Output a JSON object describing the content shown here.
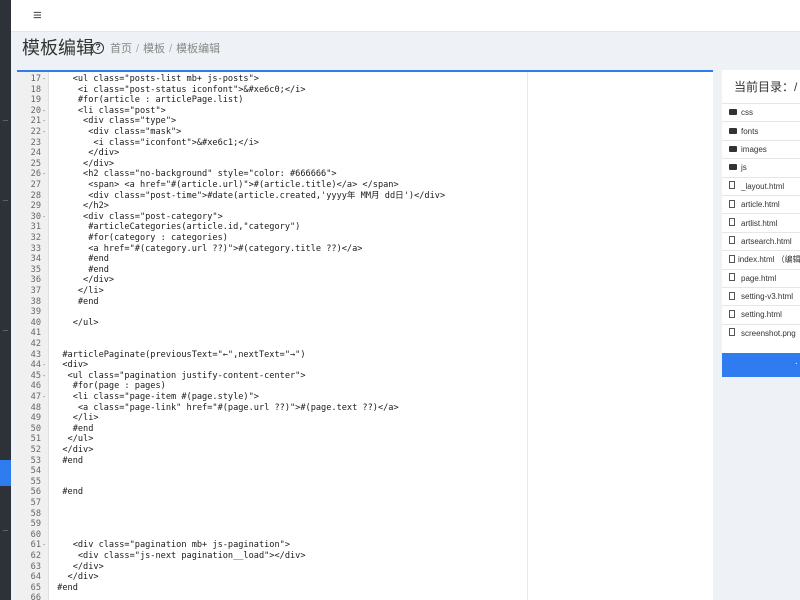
{
  "header": {
    "menu_icon": "menu-icon",
    "page_title": "模板编辑",
    "help_icon": "question-icon"
  },
  "breadcrumb": [
    "首页",
    "模板",
    "模板编辑"
  ],
  "editor": {
    "lines": [
      {
        "n": "17",
        "fold": "-",
        "text": "    <ul class=\"posts-list mb+ js-posts\">"
      },
      {
        "n": "18",
        "fold": "",
        "text": "     <i class=\"post-status iconfont\">&#xe6c0;</i>"
      },
      {
        "n": "19",
        "fold": "",
        "text": "     #for(article : articlePage.list)"
      },
      {
        "n": "20",
        "fold": "-",
        "text": "     <li class=\"post\">"
      },
      {
        "n": "21",
        "fold": "-",
        "text": "      <div class=\"type\">"
      },
      {
        "n": "22",
        "fold": "-",
        "text": "       <div class=\"mask\">"
      },
      {
        "n": "23",
        "fold": "",
        "text": "        <i class=\"iconfont\">&#xe6c1;</i>"
      },
      {
        "n": "24",
        "fold": "",
        "text": "       </div>"
      },
      {
        "n": "25",
        "fold": "",
        "text": "      </div>"
      },
      {
        "n": "26",
        "fold": "-",
        "text": "      <h2 class=\"no-background\" style=\"color: #666666\">"
      },
      {
        "n": "27",
        "fold": "",
        "text": "       <span> <a href=\"#(article.url)\">#(article.title)</a> </span>"
      },
      {
        "n": "28",
        "fold": "",
        "text": "       <div class=\"post-time\">#date(article.created,'yyyy年 MM月 dd日')</div>"
      },
      {
        "n": "29",
        "fold": "",
        "text": "      </h2>"
      },
      {
        "n": "30",
        "fold": "-",
        "text": "      <div class=\"post-category\">"
      },
      {
        "n": "31",
        "fold": "",
        "text": "       #articleCategories(article.id,\"category\")"
      },
      {
        "n": "32",
        "fold": "",
        "text": "       #for(category : categories)"
      },
      {
        "n": "33",
        "fold": "",
        "text": "       <a href=\"#(category.url ??)\">#(category.title ??)</a>"
      },
      {
        "n": "34",
        "fold": "",
        "text": "       #end"
      },
      {
        "n": "35",
        "fold": "",
        "text": "       #end"
      },
      {
        "n": "36",
        "fold": "",
        "text": "      </div>"
      },
      {
        "n": "37",
        "fold": "",
        "text": "     </li>"
      },
      {
        "n": "38",
        "fold": "",
        "text": "     #end"
      },
      {
        "n": "39",
        "fold": "",
        "text": ""
      },
      {
        "n": "40",
        "fold": "",
        "text": "    </ul>"
      },
      {
        "n": "41",
        "fold": "",
        "text": ""
      },
      {
        "n": "42",
        "fold": "",
        "text": ""
      },
      {
        "n": "43",
        "fold": "",
        "text": "  #articlePaginate(previousText=\"←\",nextText=\"→\")"
      },
      {
        "n": "44",
        "fold": "-",
        "text": "  <div>"
      },
      {
        "n": "45",
        "fold": "-",
        "text": "   <ul class=\"pagination justify-content-center\">"
      },
      {
        "n": "46",
        "fold": "",
        "text": "    #for(page : pages)"
      },
      {
        "n": "47",
        "fold": "-",
        "text": "    <li class=\"page-item #(page.style)\">"
      },
      {
        "n": "48",
        "fold": "",
        "text": "     <a class=\"page-link\" href=\"#(page.url ??)\">#(page.text ??)</a>"
      },
      {
        "n": "49",
        "fold": "",
        "text": "    </li>"
      },
      {
        "n": "50",
        "fold": "",
        "text": "    #end"
      },
      {
        "n": "51",
        "fold": "",
        "text": "   </ul>"
      },
      {
        "n": "52",
        "fold": "",
        "text": "  </div>"
      },
      {
        "n": "53",
        "fold": "",
        "text": "  #end"
      },
      {
        "n": "54",
        "fold": "",
        "text": ""
      },
      {
        "n": "55",
        "fold": "",
        "text": ""
      },
      {
        "n": "56",
        "fold": "",
        "text": "  #end"
      },
      {
        "n": "57",
        "fold": "",
        "text": ""
      },
      {
        "n": "58",
        "fold": "",
        "text": ""
      },
      {
        "n": "59",
        "fold": "",
        "text": ""
      },
      {
        "n": "60",
        "fold": "",
        "text": ""
      },
      {
        "n": "61",
        "fold": "-",
        "text": "    <div class=\"pagination mb+ js-pagination\">"
      },
      {
        "n": "62",
        "fold": "",
        "text": "     <div class=\"js-next pagination__load\"></div>"
      },
      {
        "n": "63",
        "fold": "",
        "text": "    </div>"
      },
      {
        "n": "64",
        "fold": "",
        "text": "   </div>"
      },
      {
        "n": "65",
        "fold": "",
        "text": " #end"
      },
      {
        "n": "66",
        "fold": "",
        "text": ""
      }
    ]
  },
  "file_panel": {
    "title": "当前目录：/",
    "items": [
      {
        "name": "css",
        "type": "folder"
      },
      {
        "name": "fonts",
        "type": "folder"
      },
      {
        "name": "images",
        "type": "folder"
      },
      {
        "name": "js",
        "type": "folder"
      },
      {
        "name": "_layout.html",
        "type": "file"
      },
      {
        "name": "article.html",
        "type": "file"
      },
      {
        "name": "artlist.html",
        "type": "file"
      },
      {
        "name": "artsearch.html",
        "type": "file"
      },
      {
        "name": "index.html （编辑",
        "type": "file"
      },
      {
        "name": "page.html",
        "type": "file"
      },
      {
        "name": "setting-v3.html",
        "type": "file"
      },
      {
        "name": "setting.html",
        "type": "file"
      },
      {
        "name": "screenshot.png",
        "type": "file"
      }
    ],
    "button_label": "·"
  },
  "colors": {
    "accent": "#2f7cf0",
    "sidebar_bg": "#2d3238"
  }
}
